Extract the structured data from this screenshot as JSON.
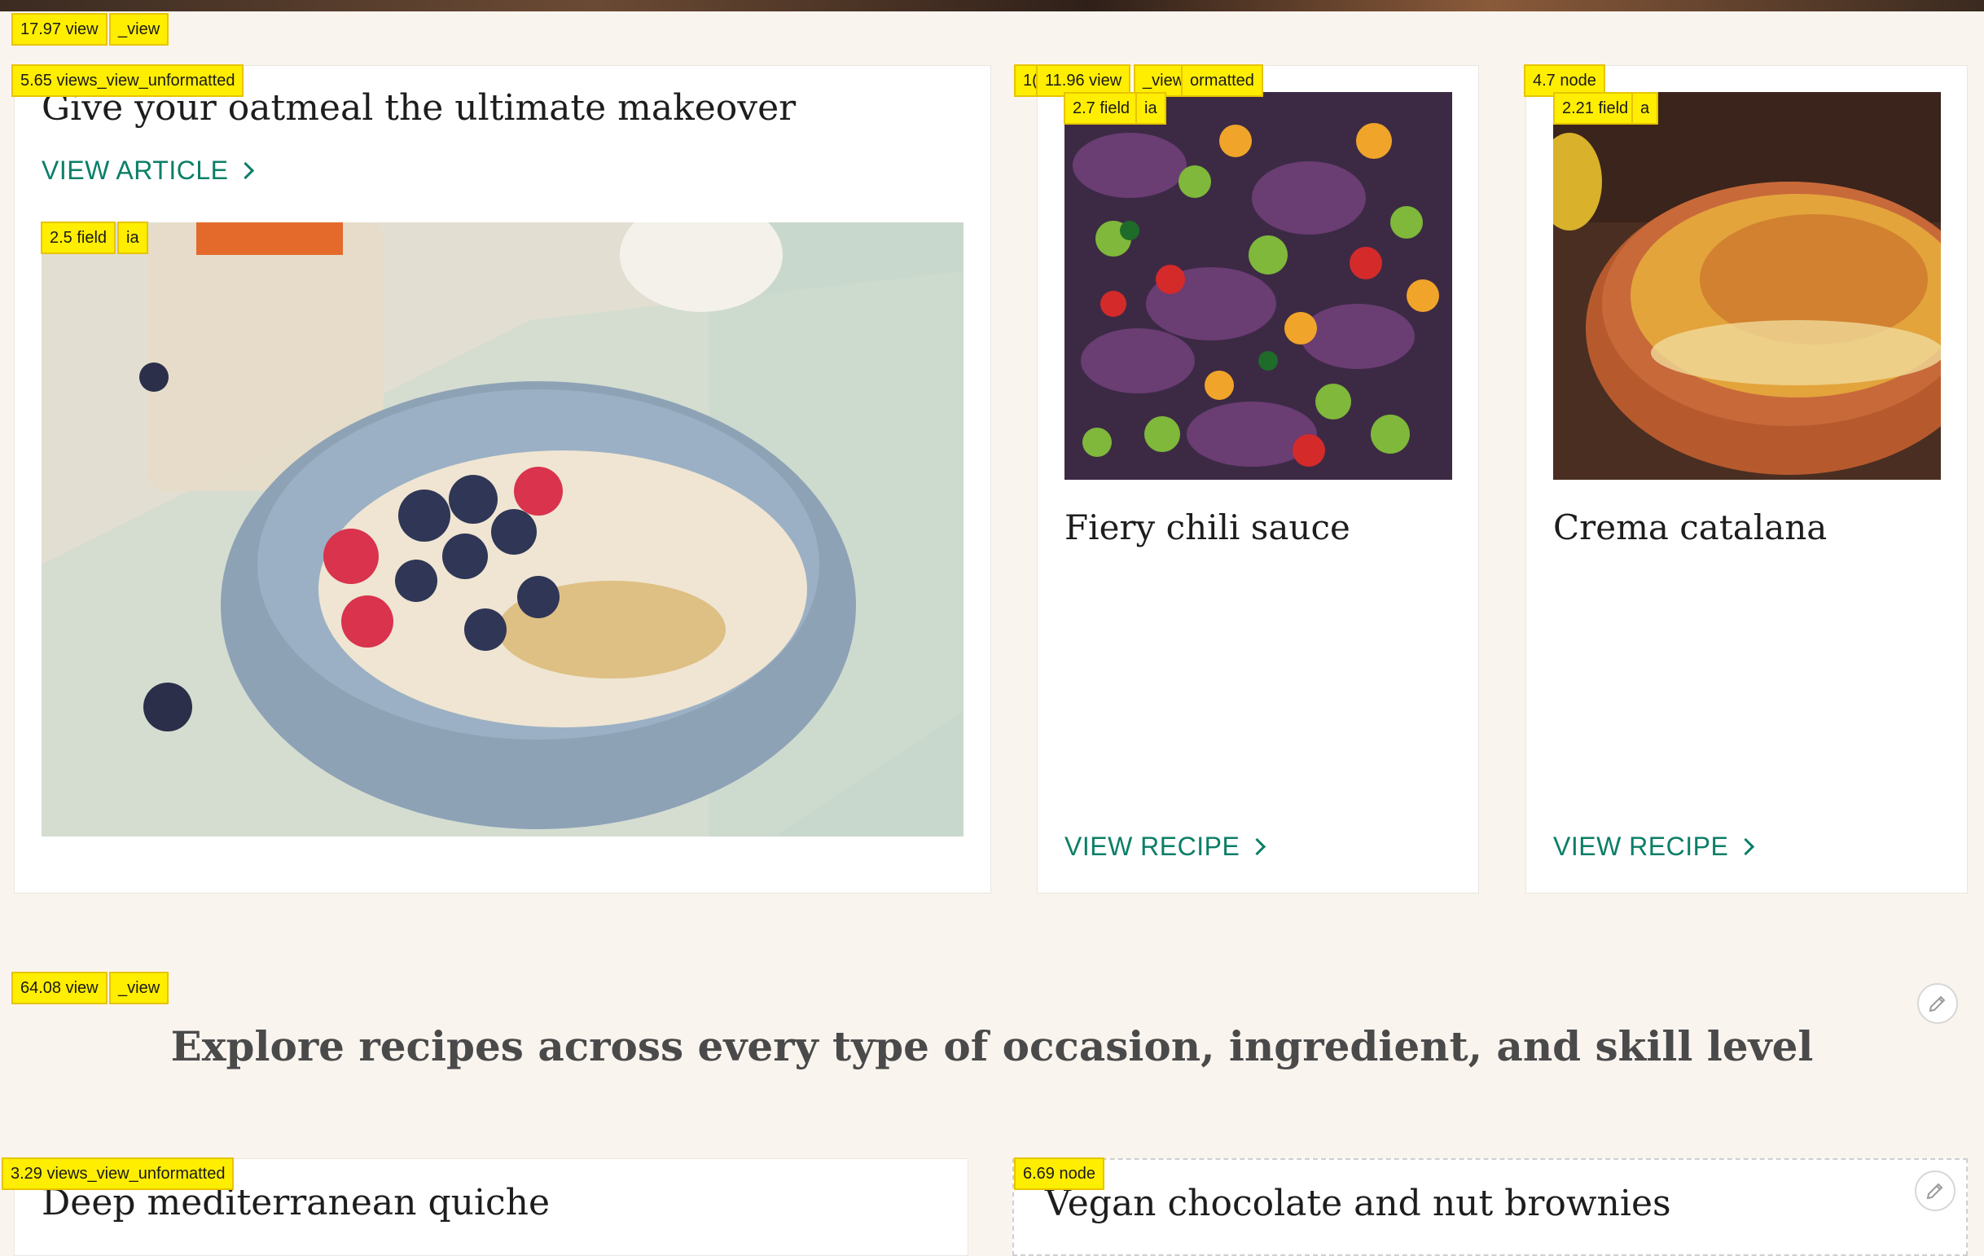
{
  "debug_tags": {
    "t1": "17.97 view",
    "t1b": "_view",
    "t2": "5.65 views_view_unformatted",
    "t3": "2.5 field",
    "t3b": "ia",
    "t4a": "1(",
    "t4": "11.96 view",
    "t4b": "_view",
    "t4c": "ormatted",
    "t5": "2.7 field",
    "t5b": "ia",
    "t6": "4.7 node",
    "t7": "2.21 field",
    "t7b": "a",
    "t8": "64.08 view",
    "t8b": "_view",
    "t9": "3.29 views_view_unformatted",
    "t10": "6.69 node"
  },
  "featured": {
    "title": "Give your oatmeal the ultimate makeover",
    "link": "VIEW ARTICLE"
  },
  "cards": [
    {
      "title": "Fiery chili sauce",
      "link": "VIEW RECIPE"
    },
    {
      "title": "Crema catalana",
      "link": "VIEW RECIPE"
    }
  ],
  "section": {
    "heading": "Explore recipes across every type of occasion, ingredient, and skill level"
  },
  "bottom_cards": [
    {
      "title": "Deep mediterranean quiche"
    },
    {
      "title": "Vegan chocolate and nut brownies"
    }
  ],
  "colors": {
    "accent": "#0b7e67",
    "background": "#faf4ef",
    "tag": "#ffee00"
  },
  "icons": {
    "edit": "pencil-icon",
    "chevron": "chevron-right-icon"
  }
}
